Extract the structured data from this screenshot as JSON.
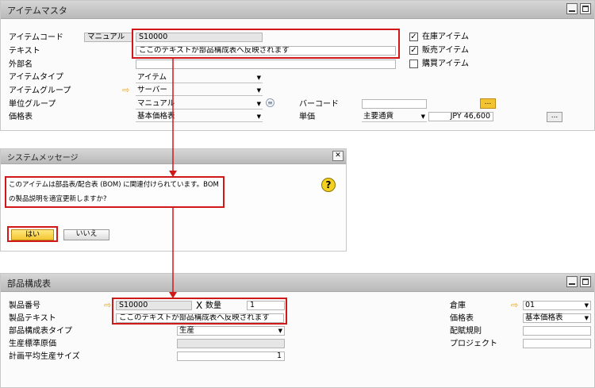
{
  "item_master": {
    "title": "アイテムマスタ",
    "labels": {
      "item_code": "アイテムコード",
      "text": "テキスト",
      "foreign_name": "外部名",
      "item_type": "アイテムタイプ",
      "item_group": "アイテムグループ",
      "uom_group": "単位グループ",
      "price_list": "価格表",
      "barcode": "バーコード",
      "unit_price": "単価"
    },
    "item_code_mode": "マニュアル",
    "item_code": "S10000",
    "text": "ここのテキストが部品構成表へ反映されます",
    "foreign_name": "",
    "item_type": "アイテム",
    "item_group": "サーバー",
    "uom_group": "マニュアル",
    "price_list": "基本価格表",
    "barcode": "",
    "currency": "主要通貨",
    "unit_price_value": "JPY 46,600",
    "dots": "...",
    "checkboxes": [
      {
        "label": "在庫アイテム",
        "checked": true
      },
      {
        "label": "販売アイテム",
        "checked": true
      },
      {
        "label": "購買アイテム",
        "checked": false
      }
    ]
  },
  "system_message": {
    "title": "システムメッセージ",
    "close": "✕",
    "line1": "このアイテムは部品表/配合表 (BOM) に関連付けられています。BOM",
    "line2": "の製品説明を適宜更新しますか?",
    "question_icon": "?",
    "yes": "はい",
    "no": "いいえ"
  },
  "bom": {
    "title": "部品構成表",
    "labels": {
      "product_no": "製品番号",
      "product_text": "製品テキスト",
      "bom_type": "部品構成表タイプ",
      "std_cost": "生産標準原価",
      "planned_size": "計画平均生産サイズ",
      "qty": "数量",
      "warehouse": "倉庫",
      "price_list": "価格表",
      "distribution_rule": "配賦規則",
      "project": "プロジェクト"
    },
    "x_mark": "X",
    "product_no": "S10000",
    "qty": "1",
    "product_text": "ここのテキストが部品構成表へ反映されます",
    "bom_type": "生産",
    "std_cost": "",
    "planned_size": "1",
    "warehouse": "01",
    "price_list": "基本価格表",
    "distribution_rule": "",
    "project": ""
  },
  "colors": {
    "highlight": "#d01818",
    "arrow": "#f0a020",
    "title_bar": "#c4c4c4"
  }
}
